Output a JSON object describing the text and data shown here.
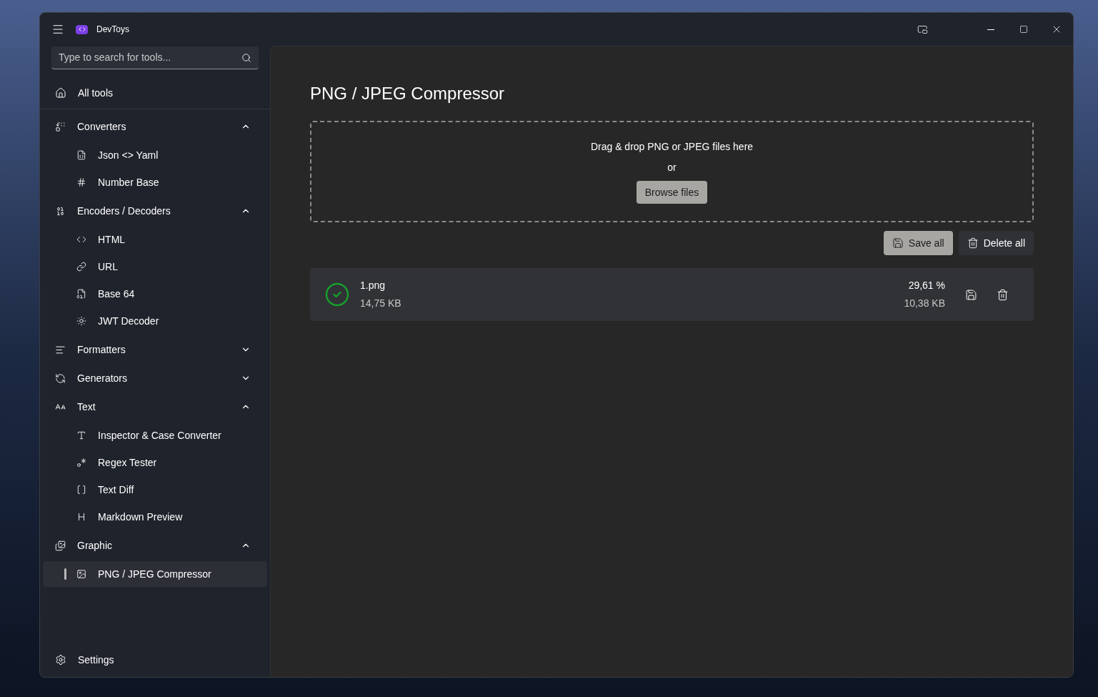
{
  "window": {
    "title": "DevToys"
  },
  "search": {
    "placeholder": "Type to search for tools..."
  },
  "home": {
    "label": "All tools"
  },
  "sidebar": {
    "items": [
      {
        "label": "Converters",
        "expanded": true,
        "children": [
          {
            "label": "Json <> Yaml",
            "selected": false
          },
          {
            "label": "Number Base",
            "selected": false
          }
        ]
      },
      {
        "label": "Encoders / Decoders",
        "expanded": true,
        "children": [
          {
            "label": "HTML",
            "selected": false
          },
          {
            "label": "URL",
            "selected": false
          },
          {
            "label": "Base 64",
            "selected": false
          },
          {
            "label": "JWT Decoder",
            "selected": false
          }
        ]
      },
      {
        "label": "Formatters",
        "expanded": false
      },
      {
        "label": "Generators",
        "expanded": false
      },
      {
        "label": "Text",
        "expanded": true,
        "children": [
          {
            "label": "Inspector & Case Converter",
            "selected": false
          },
          {
            "label": "Regex Tester",
            "selected": false
          },
          {
            "label": "Text Diff",
            "selected": false
          },
          {
            "label": "Markdown Preview",
            "selected": false
          }
        ]
      },
      {
        "label": "Graphic",
        "expanded": true,
        "children": [
          {
            "label": "PNG / JPEG Compressor",
            "selected": true
          }
        ]
      }
    ]
  },
  "settings": {
    "label": "Settings"
  },
  "page": {
    "title": "PNG / JPEG Compressor",
    "dropzone": {
      "text": "Drag & drop PNG or JPEG files here",
      "or": "or",
      "button": "Browse files"
    },
    "actions": [
      "Save all",
      "Delete all"
    ],
    "files": [
      {
        "name": "1.png",
        "original_size": "14,75 KB",
        "ratio": "29,61 %",
        "new_size": "10,38 KB",
        "done": true
      }
    ]
  }
}
